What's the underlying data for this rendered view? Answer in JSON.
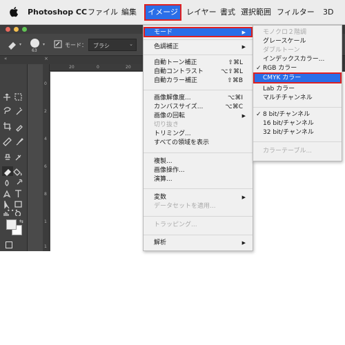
{
  "menubar": {
    "app_name": "Photoshop CC",
    "items": [
      "ファイル",
      "編集",
      "イメージ",
      "レイヤー",
      "書式",
      "選択範囲",
      "フィルター",
      "3D"
    ],
    "active_item": "イメージ"
  },
  "options_bar": {
    "brush_size": "63",
    "mode_label": "モード：",
    "mode_value": "ブラシ"
  },
  "ruler": {
    "h": [
      "20",
      "0",
      "20"
    ],
    "v": [
      "0",
      "2",
      "4",
      "6",
      "8",
      "1",
      "1"
    ]
  },
  "image_menu": {
    "mode": "モード",
    "adjustments": "色調補正",
    "auto_tone": "自動トーン補正",
    "auto_tone_sc": "⇧⌘L",
    "auto_contrast": "自動コントラスト",
    "auto_contrast_sc": "⌥⇧⌘L",
    "auto_color": "自動カラー補正",
    "auto_color_sc": "⇧⌘B",
    "image_size": "画像解像度...",
    "image_size_sc": "⌥⌘I",
    "canvas_size": "カンバスサイズ...",
    "canvas_size_sc": "⌥⌘C",
    "rotation": "画像の回転",
    "crop": "切り抜き",
    "trim": "トリミング...",
    "reveal_all": "すべての領域を表示",
    "duplicate": "複製...",
    "apply_image": "画像操作...",
    "calculations": "演算...",
    "variables": "変数",
    "apply_data_set": "データセットを適用...",
    "trap": "トラッピング...",
    "analysis": "解析"
  },
  "mode_submenu": {
    "bitmap": "モノクロ２階調",
    "grayscale": "グレースケール",
    "duotone": "ダブルトーン",
    "indexed": "インデックスカラー...",
    "rgb": "RGB カラー",
    "cmyk": "CMYK カラー",
    "lab": "Lab カラー",
    "multichannel": "マルチチャンネル",
    "bit8": "8 bit/チャンネル",
    "bit16": "16 bit/チャンネル",
    "bit32": "32 bit/チャンネル",
    "color_table": "カラーテーブル...",
    "checkmark": "✓"
  },
  "colors": {
    "highlight": "#2a6ee8",
    "annotation": "#e02020",
    "menu_bg": "#f0f0f0",
    "ps_dark": "#535353"
  }
}
